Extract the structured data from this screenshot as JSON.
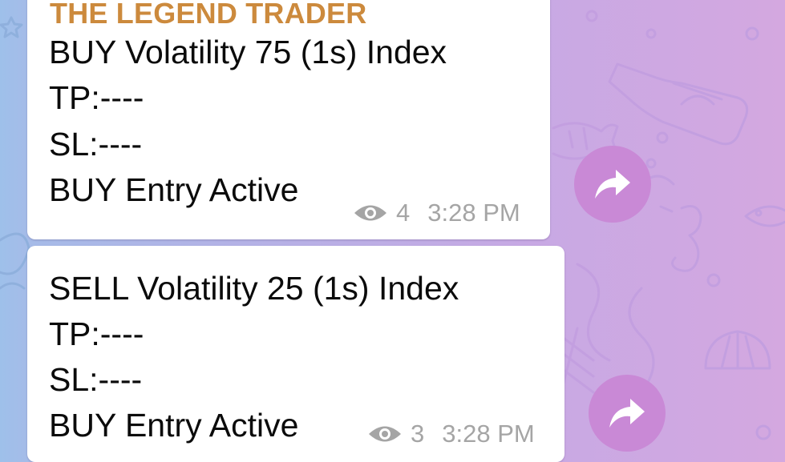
{
  "colors": {
    "sender_name": "#cc8a3d",
    "message_text": "#0b0b0b",
    "meta_text": "#a5a5a5",
    "share_button": "#c989d6",
    "bubble": "#ffffff"
  },
  "messages": [
    {
      "sender": "THE LEGEND TRADER",
      "lines": [
        "BUY Volatility 75 (1s) Index",
        "TP:----",
        "SL:----",
        "BUY Entry Active"
      ],
      "views": "4",
      "time": "3:28 PM",
      "view_icon": "eye-icon",
      "share_icon": "share-arrow-icon"
    },
    {
      "lines": [
        "SELL Volatility 25 (1s) Index",
        "TP:----",
        "SL:----",
        "BUY Entry Active"
      ],
      "views": "3",
      "time": "3:28 PM",
      "view_icon": "eye-icon",
      "share_icon": "share-arrow-icon"
    }
  ]
}
